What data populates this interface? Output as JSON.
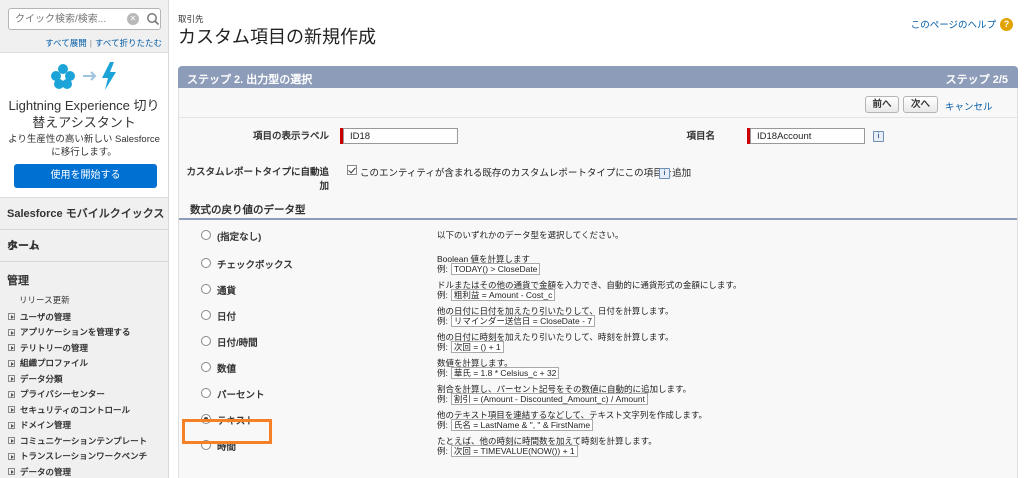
{
  "sidebar": {
    "search_placeholder": "クイック検索/検索...",
    "expand_all": "すべて展開",
    "collapse_all": "すべて折りたたむ",
    "lightning": {
      "title": "Lightning Experience 切り替えアシスタント",
      "description": "より生産性の高い新しい Salesforce に移行します。",
      "start_button": "使用を開始する"
    },
    "mobile_quickstart": "Salesforce モバイルクイックスタート",
    "home": "ホーム",
    "admin_title": "管理",
    "release_update": "リリース更新",
    "admin_items": [
      "ユーザの管理",
      "アプリケーションを管理する",
      "テリトリーの管理",
      "組織プロファイル",
      "データ分類",
      "プライバシーセンター",
      "セキュリティのコントロール",
      "ドメイン管理",
      "コミュニケーションテンプレート",
      "トランスレーションワークベンチ",
      "データの管理"
    ]
  },
  "header": {
    "breadcrumb": "取引先",
    "title": "カスタム項目の新規作成",
    "help_link": "このページのヘルプ"
  },
  "step": {
    "title": "ステップ 2. 出力型の選択",
    "count": "ステップ 2/5"
  },
  "buttons": {
    "prev": "前へ",
    "next": "次へ",
    "cancel": "キャンセル"
  },
  "form": {
    "display_label": "項目の表示ラベル",
    "display_value": "ID18",
    "api_name_label": "項目名",
    "api_name_value": "ID18Account",
    "auto_add_label": "カスタムレポートタイプに自動追加",
    "auto_add_text": "このエンティティが含まれる既存のカスタムレポートタイプにこの項目を追加",
    "auto_add_checked": true
  },
  "section_title": "数式の戻り値のデータ型",
  "return_types": [
    {
      "name": "(指定なし)",
      "desc": "以下のいずれかのデータ型を選択してください。",
      "example": "",
      "checked": false
    },
    {
      "name": "チェックボックス",
      "desc": "Boolean 値を計算します",
      "example": "TODAY() > CloseDate",
      "checked": false
    },
    {
      "name": "通貨",
      "desc": "ドルまたはその他の通貨で金額を入力でき、自動的に通貨形式の金額にします。",
      "example": "粗利益 = Amount - Cost_c",
      "checked": false
    },
    {
      "name": "日付",
      "desc": "他の日付に日付を加えたり引いたりして、日付を計算します。",
      "example": "リマインダー送信日 = CloseDate - 7",
      "checked": false
    },
    {
      "name": "日付/時間",
      "desc": "他の日付に時刻を加えたり引いたりして、時刻を計算します。",
      "example": "次回 = () + 1",
      "checked": false
    },
    {
      "name": "数値",
      "desc": "数値を計算します。",
      "example": "華氏 = 1.8 * Celsius_c + 32",
      "checked": false
    },
    {
      "name": "パーセント",
      "desc": "割合を計算し、パーセント記号をその数値に自動的に追加します。",
      "example": "割引 = (Amount - Discounted_Amount_c) / Amount",
      "checked": false
    },
    {
      "name": "テキスト",
      "desc": "他のテキスト項目を連結するなどして、テキスト文字列を作成します。",
      "example": "氏名 = LastName & \", \" & FirstName",
      "checked": true
    },
    {
      "name": "時間",
      "desc": "たとえば、他の時刻に時間数を加えて時刻を計算します。",
      "example": "次回 = TIMEVALUE(NOW()) + 1",
      "checked": false
    }
  ],
  "example_prefix": "例:",
  "colors": {
    "accent": "#8d9cb9",
    "link": "#015ba7",
    "primary_button": "#0070d2",
    "highlight": "#f58026",
    "required": "#cc0000"
  }
}
